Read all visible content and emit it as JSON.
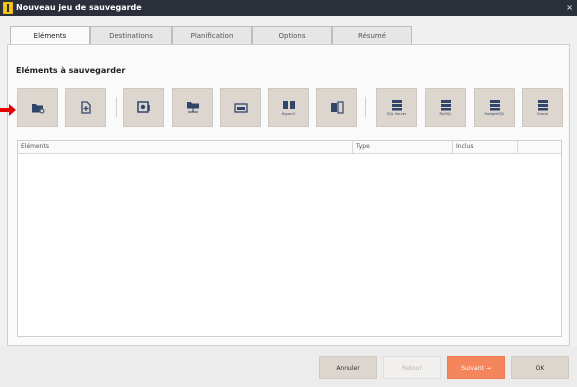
{
  "window": {
    "title": "Nouveau jeu de sauvegarde",
    "close_label": "×"
  },
  "tabs": [
    {
      "label": "Eléments",
      "active": true
    },
    {
      "label": "Destinations",
      "active": false
    },
    {
      "label": "Planification",
      "active": false
    },
    {
      "label": "Options",
      "active": false
    },
    {
      "label": "Résumé",
      "active": false
    }
  ],
  "section": {
    "title": "Eléments à sauvegarder"
  },
  "toolbar": {
    "buttons": [
      {
        "icon": "add-folder-icon",
        "caption": ""
      },
      {
        "icon": "add-file-icon",
        "caption": ""
      },
      {
        "icon": "disk-image-icon",
        "caption": ""
      },
      {
        "icon": "network-folder-icon",
        "caption": ""
      },
      {
        "icon": "server-icon",
        "caption": ""
      },
      {
        "icon": "hyper-v-icon",
        "caption": "Hyper-V"
      },
      {
        "icon": "exchange-icon",
        "caption": ""
      },
      {
        "icon": "database-icon",
        "caption": "SQL Server"
      },
      {
        "icon": "database-icon",
        "caption": "MySQL"
      },
      {
        "icon": "database-icon",
        "caption": "PostgreSQL"
      },
      {
        "icon": "database-icon",
        "caption": "Oracle"
      }
    ]
  },
  "grid": {
    "columns": [
      "Eléments",
      "Type",
      "Inclus",
      ""
    ],
    "rows": []
  },
  "footer": {
    "cancel_label": "Annuler",
    "back_label": "Retour",
    "next_label": "Suivant →",
    "ok_label": "OK"
  },
  "colors": {
    "accent": "#f5855b",
    "button_bg": "#dcd6cf",
    "icon": "#31456b",
    "pointer_arrow": "#e60000"
  }
}
